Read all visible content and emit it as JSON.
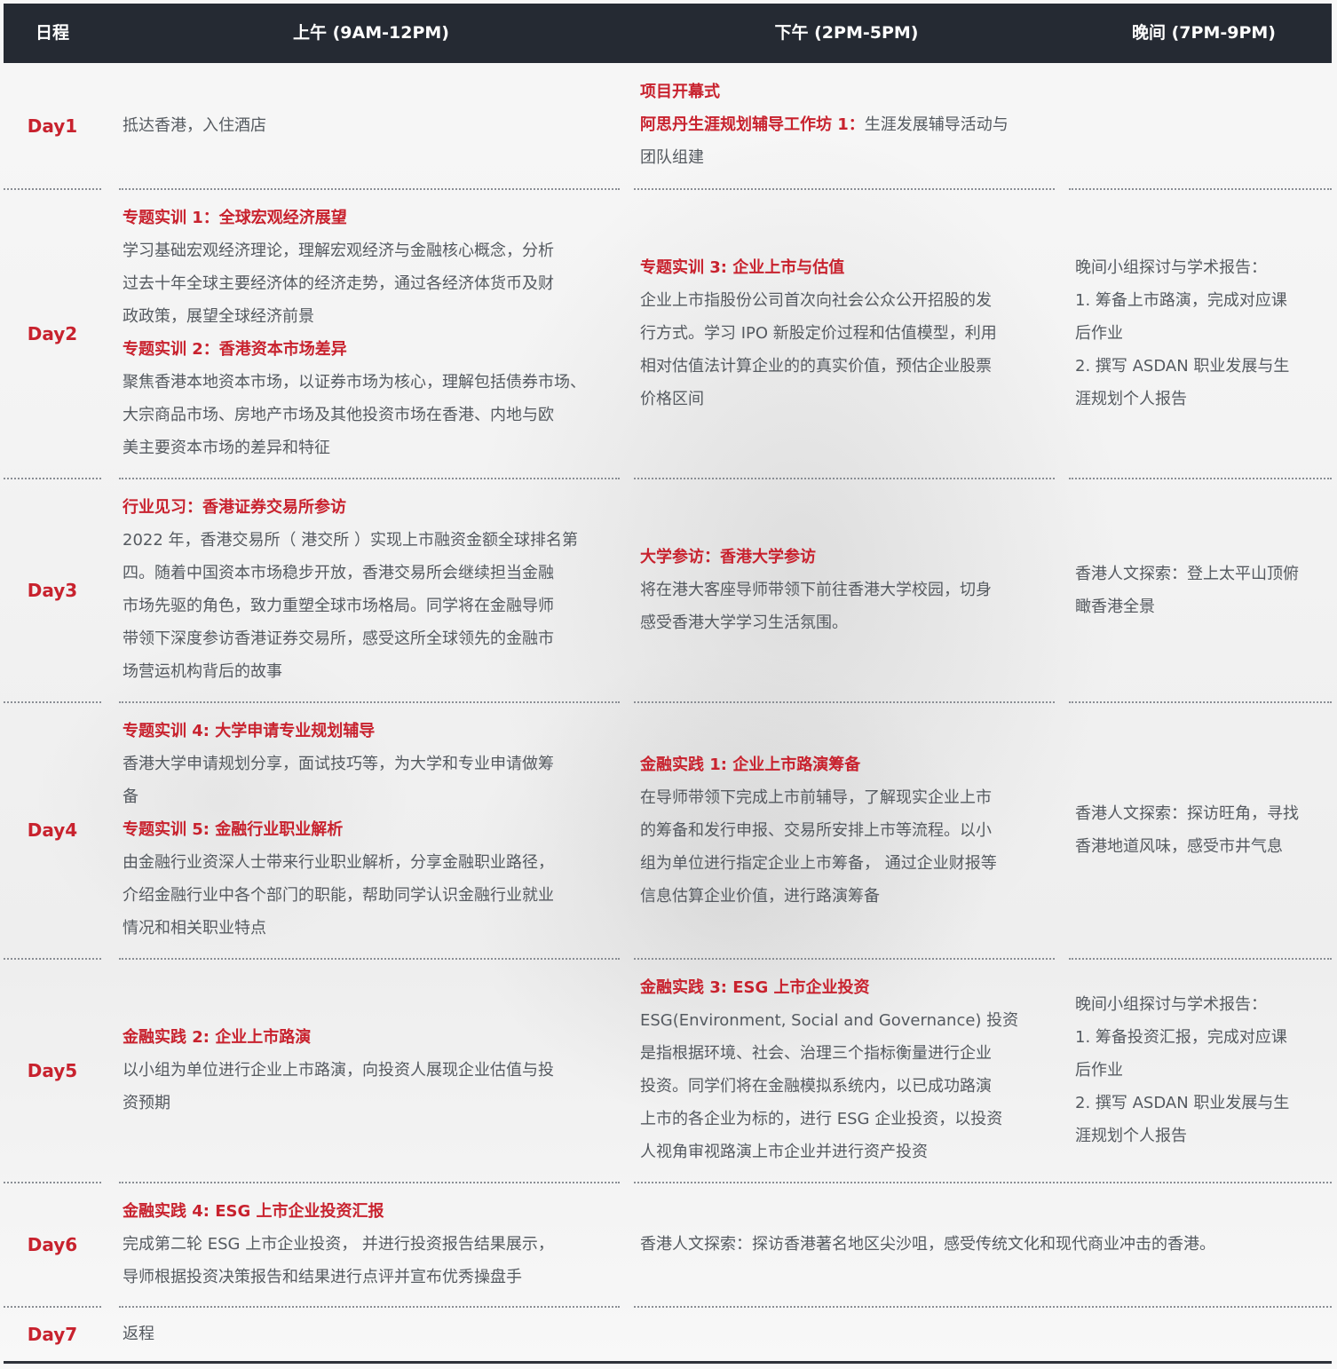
{
  "header": {
    "day": "日程",
    "am": "上午 (9AM-12PM)",
    "pm": "下午 (2PM-5PM)",
    "evening": "晚间 (7PM-9PM)"
  },
  "days": [
    {
      "day": "Day1",
      "am": {
        "p1": "抵达香港，入住酒店"
      },
      "pm": {
        "t1": "项目开幕式",
        "t2": "阿思丹生涯规划辅导工作坊 1：",
        "t2_rest": "生涯发展辅导活动与",
        "p2": "团队组建"
      }
    },
    {
      "day": "Day2",
      "am": {
        "t1": "专题实训 1：全球宏观经济展望",
        "p1": [
          "学习基础宏观经济理论，理解宏观经济与金融核心概念，分析",
          "过去十年全球主要经济体的经济走势，通过各经济体货币及财",
          "政政策，展望全球经济前景"
        ],
        "t2": "专题实训 2：香港资本市场差异",
        "p2": [
          "聚焦香港本地资本市场，以证券市场为核心，理解包括债券市场、",
          "大宗商品市场、房地产市场及其他投资市场在香港、内地与欧",
          "美主要资本市场的差异和特征"
        ]
      },
      "pm": {
        "t1": "专题实训 3: 企业上市与估值",
        "p1": [
          "企业上市指股份公司首次向社会公众公开招股的发",
          "行方式。学习 IPO 新股定价过程和估值模型，利用",
          "相对估值法计算企业的的真实价值，预估企业股票",
          "价格区间"
        ]
      },
      "evening": {
        "p1": [
          "晚间小组探讨与学术报告：",
          "1. 筹备上市路演，完成对应课",
          "后作业",
          "2. 撰写 ASDAN 职业发展与生",
          "涯规划个人报告"
        ]
      }
    },
    {
      "day": "Day3",
      "am": {
        "t1": "行业见习：香港证券交易所参访",
        "p1": [
          "2022 年，香港交易所（ 港交所 ）实现上市融资金额全球排名第",
          "四。随着中国资本市场稳步开放，香港交易所会继续担当金融",
          "市场先驱的角色，致力重塑全球市场格局。同学将在金融导师",
          "带领下深度参访香港证券交易所，感受这所全球领先的金融市",
          "场营运机构背后的故事"
        ]
      },
      "pm": {
        "t1": "大学参访：香港大学参访",
        "p1": [
          "将在港大客座导师带领下前往香港大学校园，切身",
          "感受香港大学学习生活氛围。"
        ]
      },
      "evening": {
        "p1": [
          "香港人文探索：登上太平山顶俯",
          "瞰香港全景"
        ]
      }
    },
    {
      "day": "Day4",
      "am": {
        "t1": "专题实训 4: 大学申请专业规划辅导",
        "p1": [
          "香港大学申请规划分享，面试技巧等，为大学和专业申请做筹",
          "备"
        ],
        "t2": "专题实训 5: 金融行业职业解析",
        "p2": [
          "由金融行业资深人士带来行业职业解析，分享金融职业路径，",
          "介绍金融行业中各个部门的职能，帮助同学认识金融行业就业",
          "情况和相关职业特点"
        ]
      },
      "pm": {
        "t1": "金融实践 1: 企业上市路演筹备",
        "p1": [
          "在导师带领下完成上市前辅导，了解现实企业上市",
          "的筹备和发行申报、交易所安排上市等流程。以小",
          "组为单位进行指定企业上市筹备， 通过企业财报等",
          "信息估算企业价值，进行路演筹备"
        ]
      },
      "evening": {
        "p1": [
          "香港人文探索：探访旺角，寻找",
          "香港地道风味，感受市井气息"
        ]
      }
    },
    {
      "day": "Day5",
      "am": {
        "t1": "金融实践 2: 企业上市路演",
        "p1": [
          "以小组为单位进行企业上市路演，向投资人展现企业估值与投",
          "资预期"
        ]
      },
      "pm": {
        "t1": "金融实践 3: ESG 上市企业投资",
        "p1": [
          " ESG(Environment, Social and Governance) 投资",
          "是指根据环境、社会、治理三个指标衡量进行企业",
          "投资。同学们将在金融模拟系统内，以已成功路演",
          "上市的各企业为标的，进行 ESG 企业投资，以投资",
          "人视角审视路演上市企业并进行资产投资"
        ]
      },
      "evening": {
        "p1": [
          "晚间小组探讨与学术报告：",
          "1. 筹备投资汇报，完成对应课",
          "后作业",
          "2. 撰写 ASDAN 职业发展与生",
          "涯规划个人报告"
        ]
      }
    },
    {
      "day": "Day6",
      "am": {
        "t1": "金融实践 4: ESG 上市企业投资汇报",
        "p1": [
          "完成第二轮 ESG 上市企业投资， 并进行投资报告结果展示，",
          "导师根据投资决策报告和结果进行点评并宣布优秀操盘手"
        ]
      },
      "pm_evening": {
        "p1": "香港人文探索：探访香港著名地区尖沙咀，感受传统文化和现代商业冲击的香港。"
      }
    },
    {
      "day": "Day7",
      "am": {
        "p1": "返程"
      }
    }
  ]
}
